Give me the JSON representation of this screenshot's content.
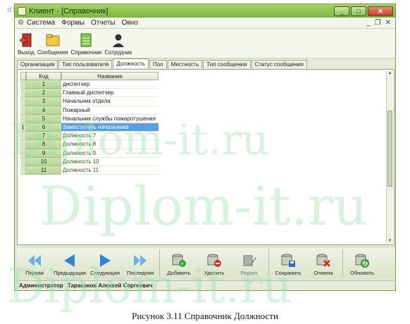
{
  "watermark_small": "dip",
  "window": {
    "title": "Клиент - [Справочник]",
    "btn_min": "_",
    "btn_max": "□",
    "btn_close": "✕"
  },
  "menu": {
    "items": [
      "Система",
      "Формы",
      "Отчеты",
      "Окно"
    ],
    "mdi_min": "_",
    "mdi_restore": "❐",
    "mdi_close": "✕"
  },
  "toolbar": {
    "items": [
      "Выход",
      "Сообщения",
      "Справочник",
      "Сотрудник"
    ]
  },
  "tabs": [
    "Организация",
    "Тип пользователя",
    "Должность",
    "Пол",
    "Местность",
    "Тип сообщения",
    "Статус сообщения"
  ],
  "active_tab": "Должность",
  "grid": {
    "headers": [
      "Код",
      "Название"
    ],
    "rows": [
      {
        "code": "1",
        "name": "диспетчер"
      },
      {
        "code": "2",
        "name": "Главный диспетчер"
      },
      {
        "code": "3",
        "name": "Начальник отдела"
      },
      {
        "code": "4",
        "name": "Пожарный"
      },
      {
        "code": "5",
        "name": "Начальник службы пожаротушения"
      },
      {
        "code": "6",
        "name": "Заместитель начальника"
      },
      {
        "code": "7",
        "name": "Должность 7"
      },
      {
        "code": "8",
        "name": "Должность 8"
      },
      {
        "code": "9",
        "name": "Должность 9"
      },
      {
        "code": "10",
        "name": "Должность 10"
      },
      {
        "code": "11",
        "name": "Должность 11"
      }
    ],
    "selected_code": "6",
    "cursor": "I"
  },
  "nav": {
    "first": "Первая",
    "prev": "Предыдущая",
    "next": "Следующая",
    "last": "Последняя",
    "add": "Добавить",
    "delete": "Удалить",
    "edit": "Редакт.",
    "save": "Сохранить",
    "cancel": "Отмена",
    "refresh": "Обновить"
  },
  "status": {
    "role": "Администратор",
    "user": "Тараканов Алексей Сергеевич"
  },
  "watermark": "Diplom-it.ru",
  "caption": "Рисунок 3.11 Справочник Должности"
}
